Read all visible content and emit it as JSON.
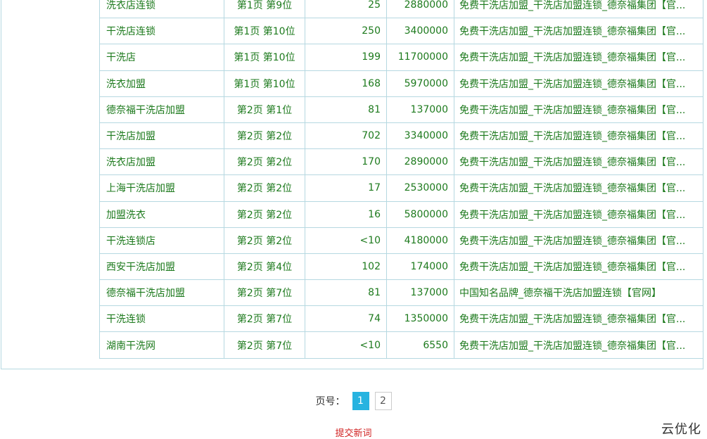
{
  "rows": [
    {
      "keyword": "洗衣店连锁",
      "rank": "第1页 第9位",
      "index": "25",
      "volume": "2880000",
      "title": "免费干洗店加盟_干洗店加盟连锁_德奈福集团【官..."
    },
    {
      "keyword": "干洗店连锁",
      "rank": "第1页 第10位",
      "index": "250",
      "volume": "3400000",
      "title": "免费干洗店加盟_干洗店加盟连锁_德奈福集团【官..."
    },
    {
      "keyword": "干洗店",
      "rank": "第1页 第10位",
      "index": "199",
      "volume": "11700000",
      "title": "免费干洗店加盟_干洗店加盟连锁_德奈福集团【官..."
    },
    {
      "keyword": "洗衣加盟",
      "rank": "第1页 第10位",
      "index": "168",
      "volume": "5970000",
      "title": "免费干洗店加盟_干洗店加盟连锁_德奈福集团【官..."
    },
    {
      "keyword": "德奈福干洗店加盟",
      "rank": "第2页 第1位",
      "index": "81",
      "volume": "137000",
      "title": "免费干洗店加盟_干洗店加盟连锁_德奈福集团【官..."
    },
    {
      "keyword": "干洗店加盟",
      "rank": "第2页 第2位",
      "index": "702",
      "volume": "3340000",
      "title": "免费干洗店加盟_干洗店加盟连锁_德奈福集团【官..."
    },
    {
      "keyword": "洗衣店加盟",
      "rank": "第2页 第2位",
      "index": "170",
      "volume": "2890000",
      "title": "免费干洗店加盟_干洗店加盟连锁_德奈福集团【官..."
    },
    {
      "keyword": "上海干洗店加盟",
      "rank": "第2页 第2位",
      "index": "17",
      "volume": "2530000",
      "title": "免费干洗店加盟_干洗店加盟连锁_德奈福集团【官..."
    },
    {
      "keyword": "加盟洗衣",
      "rank": "第2页 第2位",
      "index": "16",
      "volume": "5800000",
      "title": "免费干洗店加盟_干洗店加盟连锁_德奈福集团【官..."
    },
    {
      "keyword": "干洗连锁店",
      "rank": "第2页 第2位",
      "index": "<10",
      "volume": "4180000",
      "title": "免费干洗店加盟_干洗店加盟连锁_德奈福集团【官..."
    },
    {
      "keyword": "西安干洗店加盟",
      "rank": "第2页 第4位",
      "index": "102",
      "volume": "174000",
      "title": "免费干洗店加盟_干洗店加盟连锁_德奈福集团【官..."
    },
    {
      "keyword": "德奈福干洗店加盟",
      "rank": "第2页 第7位",
      "index": "81",
      "volume": "137000",
      "title": "中国知名品牌_德奈福干洗店加盟连锁【官网】"
    },
    {
      "keyword": "干洗连锁",
      "rank": "第2页 第7位",
      "index": "74",
      "volume": "1350000",
      "title": "免费干洗店加盟_干洗店加盟连锁_德奈福集团【官..."
    },
    {
      "keyword": "湖南干洗网",
      "rank": "第2页 第7位",
      "index": "<10",
      "volume": "6550",
      "title": "免费干洗店加盟_干洗店加盟连锁_德奈福集团【官..."
    }
  ],
  "pager": {
    "label": "页号：",
    "pages": [
      "1",
      "2"
    ],
    "current": "1"
  },
  "submit_label": "提交新词",
  "watermark": "云优化",
  "colors": {
    "row_text": "#1d7a1d",
    "border": "#b6d8e1",
    "active_page": "#27b3e0",
    "submit_link": "#d01f1f"
  }
}
